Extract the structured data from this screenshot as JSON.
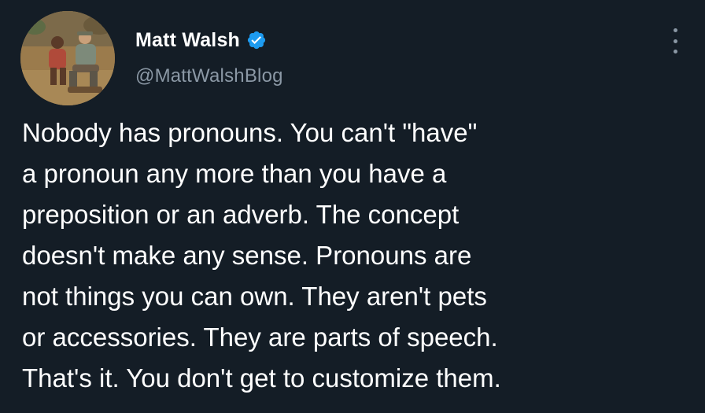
{
  "tweet": {
    "author": {
      "display_name": "Matt Walsh",
      "handle": "@MattWalshBlog",
      "verified": true,
      "avatar_icon": "profile-photo"
    },
    "more_icon": "more-options-icon",
    "text_lines": [
      "Nobody has pronouns. You can't \"have\"",
      "a pronoun any more than you have a",
      "preposition or an adverb. The concept",
      "doesn't make any sense. Pronouns are",
      "not things you can own. They aren't pets",
      "or accessories. They are parts of speech.",
      "That's it. You don't get to customize them."
    ]
  },
  "colors": {
    "background": "#141d26",
    "text": "#ffffff",
    "secondary_text": "#8b98a5",
    "verified_badge": "#1d9bf0"
  }
}
